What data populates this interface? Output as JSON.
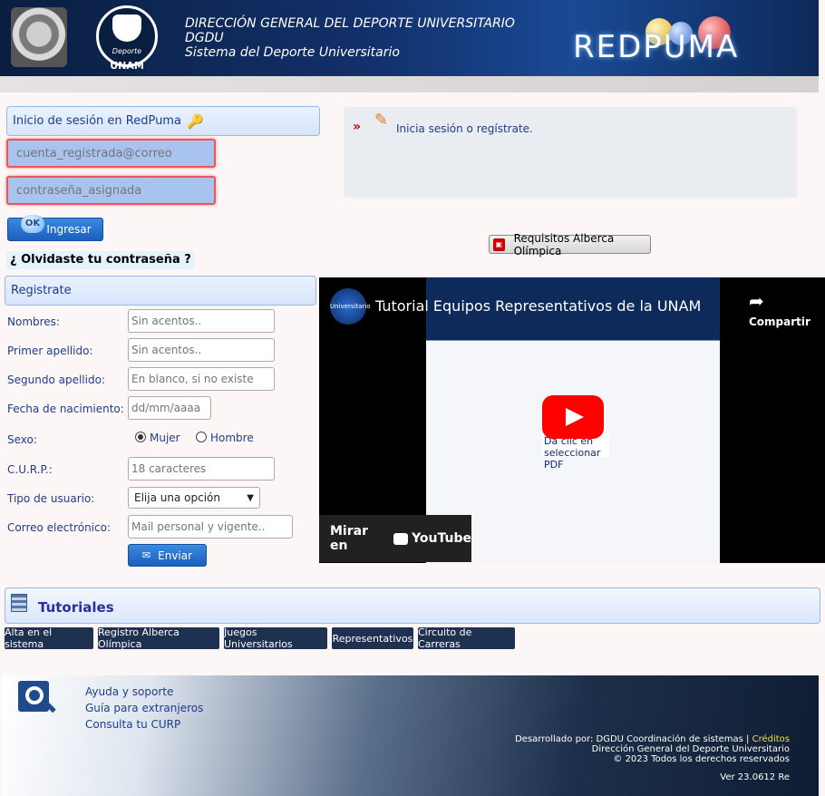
{
  "header": {
    "line1": "DIRECCIÓN GENERAL DEL DEPORTE UNIVERSITARIO",
    "line2": "DGDU",
    "line3": "Sistema del Deporte Universitario",
    "logo_sub": "Deporte",
    "logo_unam": "UNAM",
    "brand": "REDPUMA"
  },
  "login": {
    "title": "Inicio de sesión en RedPuma",
    "email_placeholder": "cuenta_registrada@correo",
    "password_placeholder": "contraseña_asignada",
    "ok_badge": "OK",
    "submit_label": "Ingresar",
    "forgot_label": "¿ Olvidaste tu contraseña ?"
  },
  "info": {
    "message": "Inicia sesión o regístrate.",
    "pdf_button": "Requisitos Alberca Olímpica"
  },
  "register": {
    "title": "Registrate",
    "fields": {
      "nombres_label": "Nombres:",
      "nombres_placeholder": "Sin acentos..",
      "primer_label": "Primer apellido:",
      "primer_placeholder": "Sin acentos..",
      "segundo_label": "Segundo apellido:",
      "segundo_placeholder": "En blanco, si no existe",
      "fecha_label": "Fecha de nacimiento:",
      "fecha_placeholder": "dd/mm/aaaa",
      "sexo_label": "Sexo:",
      "sexo_mujer": "Mujer",
      "sexo_hombre": "Hombre",
      "curp_label": "C.U.R.P.:",
      "curp_placeholder": "18 caracteres",
      "tipo_label": "Tipo de usuario:",
      "tipo_value": "Elija una opción",
      "correo_label": "Correo electrónico:",
      "correo_placeholder": "Mail personal y vigente.."
    },
    "submit_label": "Enviar"
  },
  "video": {
    "title": "Tutorial Equipos Representativos de la UNAM",
    "channel": "Universitario",
    "share": "Compartir",
    "watch_on": "Mirar en",
    "youtube": "YouTube",
    "overlay_text": "Da clic en seleccionar PDF"
  },
  "tutorials": {
    "title": "Tutoriales",
    "buttons": [
      "Alta en el sistema",
      "Registro Alberca Olímpica",
      "Juegos Universitarios",
      "Representativos",
      "Circuito de Carreras"
    ]
  },
  "footer": {
    "links": [
      "Ayuda y soporte",
      "Guía para extranjeros",
      "Consulta tu CURP"
    ],
    "developed": "Desarrollado por: DGDU Coordinación de sistemas |",
    "credits": "Créditos",
    "org": "Dirección General del Deporte Universitario",
    "copyright": "© 2023 Todos los derechos reservados",
    "version": "Ver 23.0612 Re"
  },
  "colors": {
    "accent": "#1e3d8a",
    "button": "#1a5fbf",
    "error": "#e55555"
  }
}
